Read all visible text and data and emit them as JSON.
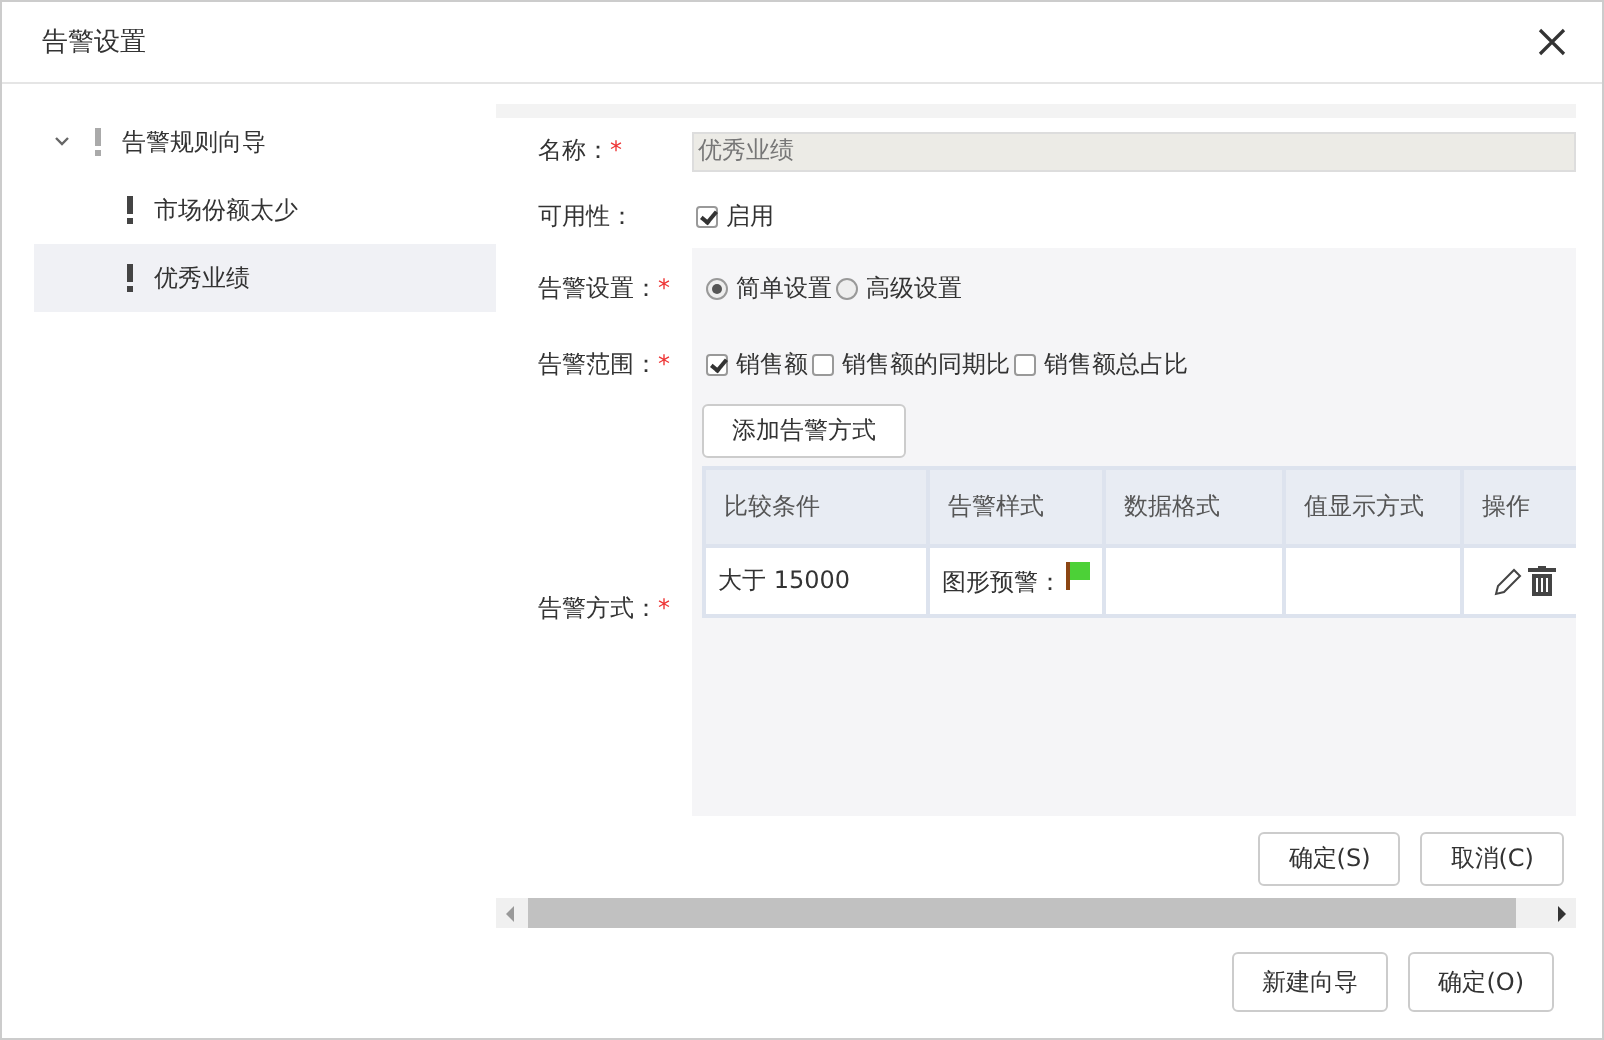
{
  "window": {
    "title": "告警设置"
  },
  "tree": [
    {
      "label": "告警规则向导",
      "expanded": true,
      "selected": false,
      "children": [
        {
          "label": "市场份额太少",
          "selected": false
        },
        {
          "label": "优秀业绩",
          "selected": true
        }
      ]
    }
  ],
  "form": {
    "required_mark": "*",
    "name": {
      "label": "名称：",
      "required": true,
      "value": "优秀业绩"
    },
    "availability": {
      "label": "可用性：",
      "required": false,
      "checkbox": {
        "label": "启用",
        "checked": true
      }
    },
    "settings": {
      "label": "告警设置：",
      "required": true,
      "options": [
        {
          "label": "简单设置",
          "selected": true
        },
        {
          "label": "高级设置",
          "selected": false
        }
      ]
    },
    "scope": {
      "label": "告警范围：",
      "required": true,
      "options": [
        {
          "label": "销售额",
          "checked": true
        },
        {
          "label": "销售额的同期比",
          "checked": false
        },
        {
          "label": "销售额总占比",
          "checked": false
        }
      ]
    },
    "method": {
      "label": "告警方式：",
      "required": true,
      "add_button": "添加告警方式",
      "table": {
        "columns": [
          "比较条件",
          "告警样式",
          "数据格式",
          "值显示方式",
          "操作"
        ],
        "rows": [
          {
            "condition": "大于 15000",
            "style": "图形预警："
          }
        ]
      }
    }
  },
  "panel_buttons": [
    "确定(S)",
    "取消(C)"
  ],
  "footer_buttons": [
    "新建向导",
    "确定(O)"
  ]
}
